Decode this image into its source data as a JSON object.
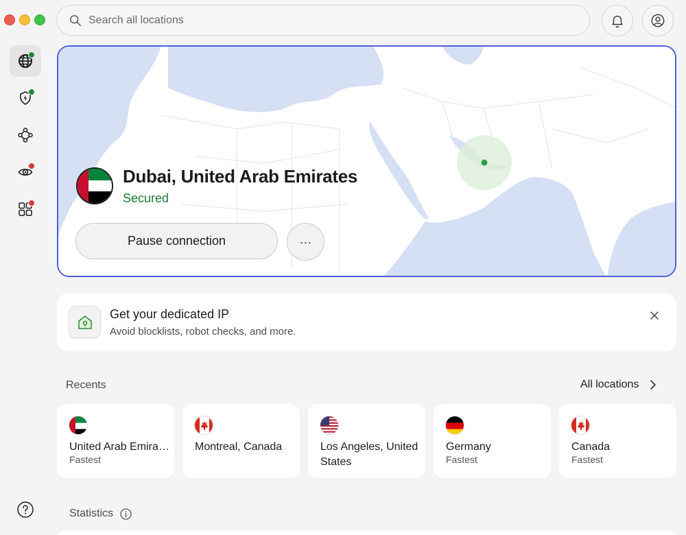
{
  "search": {
    "placeholder": "Search all locations"
  },
  "connection": {
    "location": "Dubai, United Arab Emirates",
    "status": "Secured",
    "pause_label": "Pause connection",
    "more_label": "···"
  },
  "promo": {
    "title": "Get your dedicated IP",
    "subtitle": "Avoid blocklists, robot checks, and more."
  },
  "recents": {
    "heading": "Recents",
    "all_label": "All locations",
    "items": [
      {
        "name": "United Arab Emirates",
        "sub": "Fastest",
        "flag": "uae"
      },
      {
        "name": "Montreal, Canada",
        "sub": "",
        "flag": "canada"
      },
      {
        "name": "Los Angeles, United States",
        "sub": "",
        "flag": "usa"
      },
      {
        "name": "Germany",
        "sub": "Fastest",
        "flag": "germany"
      },
      {
        "name": "Canada",
        "sub": "Fastest",
        "flag": "canada"
      }
    ]
  },
  "statistics": {
    "heading": "Statistics"
  },
  "colors": {
    "accent_border": "#4a60db",
    "secured_green": "#1f7a35",
    "map_water": "#d6e0f4",
    "badge_red": "#d33b3b",
    "badge_green": "#1f8a3a"
  },
  "icons": {
    "sidebar": [
      "globe-icon",
      "shield-bolt-icon",
      "mesh-network-icon",
      "eye-target-icon",
      "apps-grid-icon"
    ],
    "header": [
      "search-icon",
      "bell-icon",
      "account-icon"
    ]
  }
}
